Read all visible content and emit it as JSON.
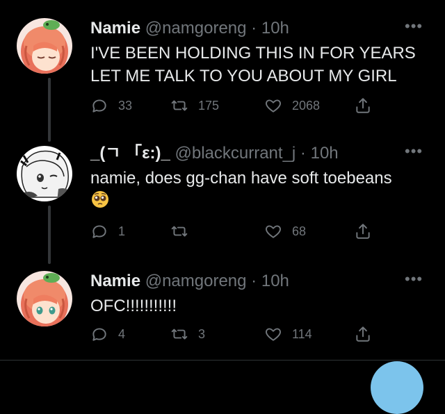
{
  "tweets": [
    {
      "name": "Namie",
      "handle": "@namgoreng",
      "dot": "·",
      "time": "10h",
      "text": "I'VE BEEN HOLDING THIS IN FOR YEARS LET ME TALK TO YOU ABOUT MY GIRL",
      "reply_count": "33",
      "retweet_count": "175",
      "like_count": "2068",
      "avatar": "orange-haired-anime-girl-avatar"
    },
    {
      "name": "_(ㄱ 「ε:)_",
      "handle": "@blackcurrant_j",
      "dot": "·",
      "time": "10h",
      "text": "namie, does gg-chan have soft toebeans",
      "emoji": "pleading-face-emoji",
      "reply_count": "1",
      "retweet_count": "",
      "like_count": "68",
      "avatar": "monochrome-anime-girl-avatar"
    },
    {
      "name": "Namie",
      "handle": "@namgoreng",
      "dot": "·",
      "time": "10h",
      "text": "OFC!!!!!!!!!!!",
      "reply_count": "4",
      "retweet_count": "3",
      "like_count": "114",
      "avatar": "orange-haired-anime-girl-avatar"
    }
  ],
  "colors": {
    "background": "#000000",
    "text_primary": "#e7e9ea",
    "text_secondary": "#71767b",
    "thread_line": "#333639",
    "fab": "#7cc4ec"
  },
  "icons": {
    "more": "more-dots-icon",
    "reply": "reply-icon",
    "retweet": "retweet-icon",
    "like": "heart-icon",
    "share": "share-icon"
  }
}
